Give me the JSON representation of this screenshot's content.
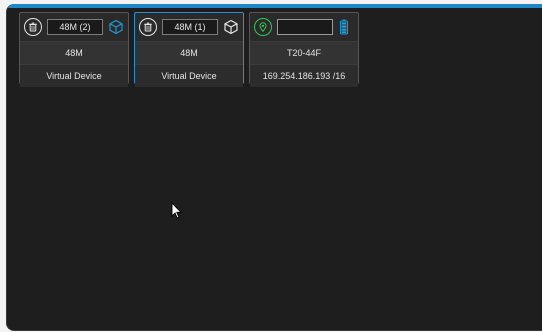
{
  "devices": [
    {
      "name": "48M (2)",
      "model": "48M",
      "type": "Virtual Device",
      "icon": "cube-icon",
      "icon_color": "#1e9ad6"
    },
    {
      "name": "48M (1)",
      "model": "48M",
      "type": "Virtual Device",
      "icon": "cube-icon",
      "icon_color": "#e6e6e6"
    },
    {
      "name": "",
      "model": "T20-44F",
      "type": "169.254.186.193 /16",
      "icon": "battery-icon",
      "icon_color": "#1e9ad6"
    }
  ],
  "colors": {
    "accent": "#1c87c9",
    "location_green": "#34c759",
    "background": "#1e1e1e"
  }
}
